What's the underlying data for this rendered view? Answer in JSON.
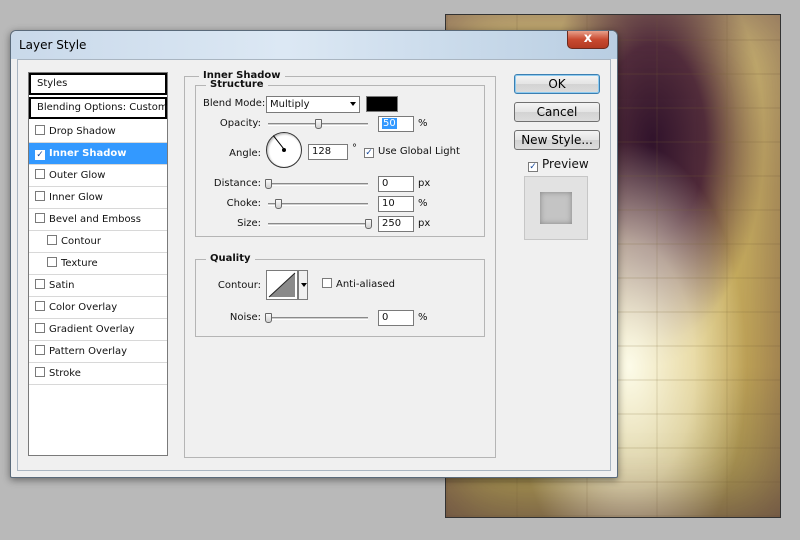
{
  "dialog": {
    "title": "Layer Style",
    "close_glyph": "x"
  },
  "styles_list": {
    "header": "Styles",
    "blending_options": "Blending Options: Custom",
    "items": [
      {
        "label": "Drop Shadow",
        "checked": false,
        "selected": false
      },
      {
        "label": "Inner Shadow",
        "checked": true,
        "selected": true
      },
      {
        "label": "Outer Glow",
        "checked": false,
        "selected": false
      },
      {
        "label": "Inner Glow",
        "checked": false,
        "selected": false
      },
      {
        "label": "Bevel and Emboss",
        "checked": false,
        "selected": false
      },
      {
        "label": "Contour",
        "checked": false,
        "selected": false,
        "sub": true
      },
      {
        "label": "Texture",
        "checked": false,
        "selected": false,
        "sub": true
      },
      {
        "label": "Satin",
        "checked": false,
        "selected": false
      },
      {
        "label": "Color Overlay",
        "checked": false,
        "selected": false
      },
      {
        "label": "Gradient Overlay",
        "checked": false,
        "selected": false
      },
      {
        "label": "Pattern Overlay",
        "checked": false,
        "selected": false
      },
      {
        "label": "Stroke",
        "checked": false,
        "selected": false
      }
    ]
  },
  "inner_shadow": {
    "title": "Inner Shadow",
    "structure": {
      "title": "Structure",
      "blend_mode_label": "Blend Mode:",
      "blend_mode_value": "Multiply",
      "shadow_color": "#000000",
      "opacity_label": "Opacity:",
      "opacity_value": "50",
      "opacity_unit": "%",
      "opacity_fraction": 0.5,
      "angle_label": "Angle:",
      "angle_value": "128",
      "angle_unit": "°",
      "use_global_light_label": "Use Global Light",
      "use_global_light_checked": true,
      "distance_label": "Distance:",
      "distance_value": "0",
      "distance_unit": "px",
      "distance_fraction": 0.0,
      "choke_label": "Choke:",
      "choke_value": "10",
      "choke_unit": "%",
      "choke_fraction": 0.1,
      "size_label": "Size:",
      "size_value": "250",
      "size_unit": "px",
      "size_fraction": 1.0
    },
    "quality": {
      "title": "Quality",
      "contour_label": "Contour:",
      "anti_aliased_label": "Anti-aliased",
      "anti_aliased_checked": false,
      "noise_label": "Noise:",
      "noise_value": "0",
      "noise_unit": "%",
      "noise_fraction": 0.0
    }
  },
  "buttons": {
    "ok": "OK",
    "cancel": "Cancel",
    "new_style": "New Style...",
    "preview_label": "Preview",
    "preview_checked": true
  },
  "colors": {
    "selection": "#3399ff",
    "title_bar": "#dce8f4",
    "close_button": "#c84a30"
  }
}
